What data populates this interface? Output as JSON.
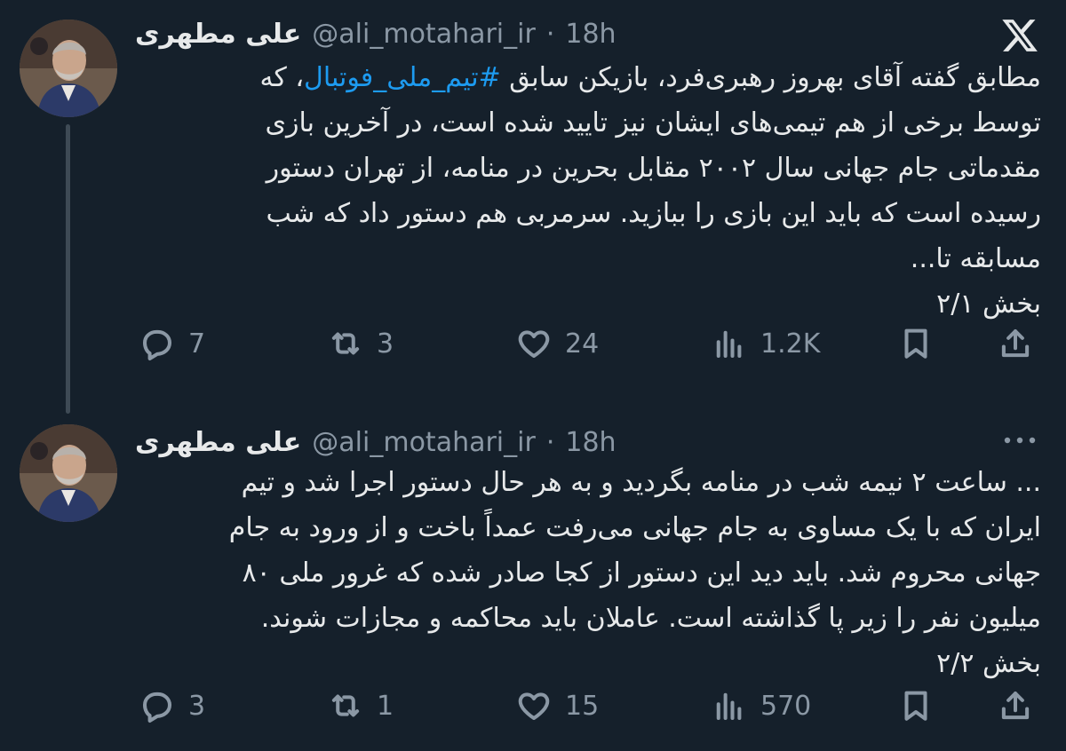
{
  "colors": {
    "background": "#15202b",
    "text": "#e7e9ea",
    "muted": "#8b98a5",
    "link": "#1d9bf0"
  },
  "tweets": [
    {
      "author": {
        "name": "علی مطهری",
        "handle": "@ali_motahari_ir",
        "separator": "·",
        "time": "18h"
      },
      "corner_icon": "x-logo-icon",
      "lines": [
        {
          "before": "مطابق گفته آقای بهروز رهبری‌فرد، بازیکن سابق ",
          "hashtag": "#تیم_ملی_فوتبال",
          "after": "، که"
        },
        {
          "text": "توسط برخی از هم تیمی‌های ایشان نیز تایید شده است، در آخرین بازی"
        },
        {
          "text": "مقدماتی جام جهانی سال ۲۰۰۲ مقابل بحرین در منامه، از تهران دستور"
        },
        {
          "text": "رسیده است که باید این بازی را ببازید. سرمربی هم دستور داد که شب"
        },
        {
          "text": "مسابقه تا..."
        },
        {
          "text": "بخش ۲/۱"
        }
      ],
      "stats": {
        "replies": "7",
        "retweets": "3",
        "likes": "24",
        "views": "1.2K"
      }
    },
    {
      "author": {
        "name": "علی مطهری",
        "handle": "@ali_motahari_ir",
        "separator": "·",
        "time": "18h"
      },
      "corner_icon": "more-icon",
      "lines": [
        {
          "text": "... ساعت ۲ نیمه شب در منامه بگردید و به هر حال دستور اجرا شد و تیم"
        },
        {
          "text": "ایران که با یک مساوی به جام جهانی می‌رفت  عمداً باخت و از ورود به جام"
        },
        {
          "text": "جهانی محروم شد. باید دید این دستور از کجا صادر شده که غرور ملی ۸۰"
        },
        {
          "text": "میلیون نفر را زیر پا گذاشته است. عاملان باید محاکمه و مجازات شوند."
        },
        {
          "text": "بخش ۲/۲"
        }
      ],
      "stats": {
        "replies": "3",
        "retweets": "1",
        "likes": "15",
        "views": "570"
      }
    }
  ],
  "icons": {
    "reply": "reply-icon",
    "retweet": "retweet-icon",
    "like": "heart-icon",
    "views": "views-icon",
    "bookmark": "bookmark-icon",
    "share": "share-icon"
  }
}
